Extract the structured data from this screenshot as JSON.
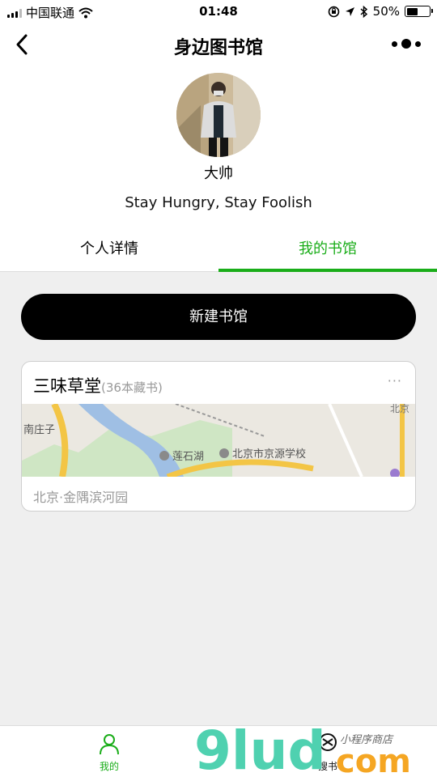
{
  "status_bar": {
    "carrier": "中国联通",
    "time": "01:48",
    "battery": "50%",
    "battery_level": 0.5
  },
  "nav": {
    "title": "身边图书馆"
  },
  "profile": {
    "name": "大帅",
    "motto": "Stay Hungry, Stay Foolish"
  },
  "tabs": [
    {
      "label": "个人详情",
      "active": false
    },
    {
      "label": "我的书馆",
      "active": true
    }
  ],
  "new_library_button": "新建书馆",
  "library": {
    "name": "三味草堂",
    "count": "(36本藏书)",
    "more": "···",
    "address": "北京·金隅滨河园",
    "map_labels": {
      "nanzhuangzi": "南庄子",
      "lianshihu": "莲石湖",
      "school": "北京市京源学校",
      "beijing_short": "北京"
    }
  },
  "tabbar": {
    "mine": "我的",
    "search": "搜书"
  },
  "watermark": {
    "brand": "9lud",
    "suffix": "com",
    "tagline": "小程序商店"
  },
  "colors": {
    "accent": "#1aad19",
    "button_bg": "#000000",
    "page_bg": "#efefef",
    "muted": "#999999"
  }
}
